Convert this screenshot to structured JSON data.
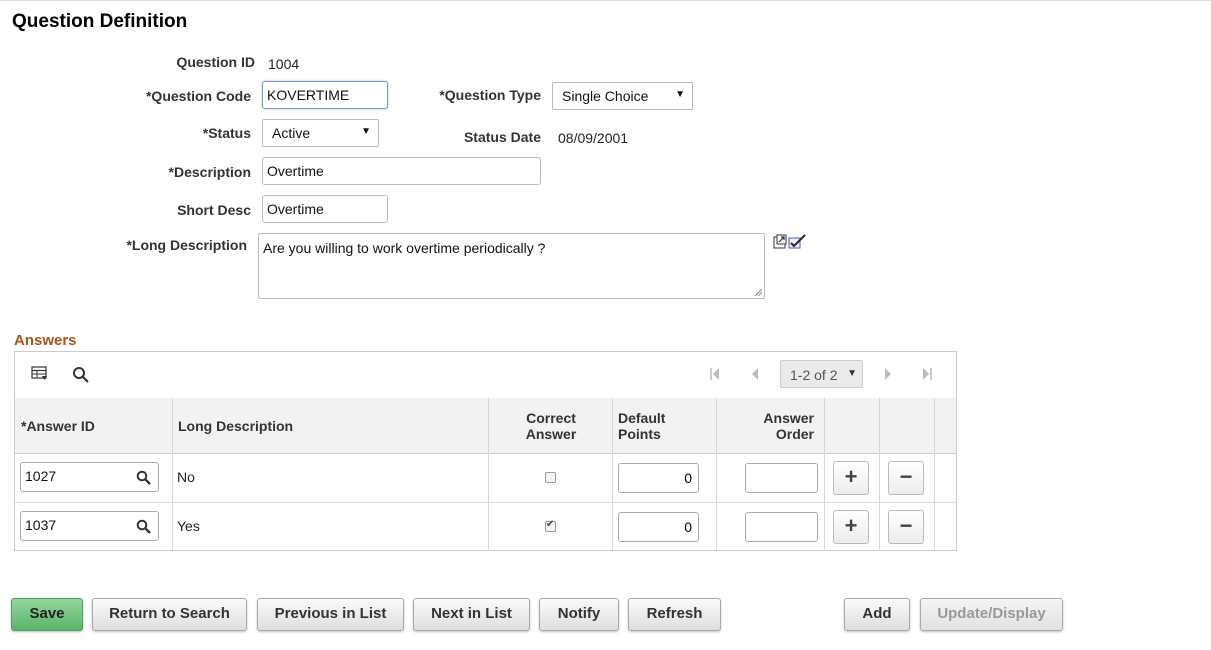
{
  "page": {
    "title": "Question Definition"
  },
  "form": {
    "question_id_label": "Question ID",
    "question_id": "1004",
    "question_code_label": "*Question Code",
    "question_code": "KOVERTIME",
    "question_type_label": "*Question Type",
    "question_type": "Single Choice",
    "status_label": "*Status",
    "status": "Active",
    "status_date_label": "Status Date",
    "status_date": "08/09/2001",
    "description_label": "*Description",
    "description": "Overtime",
    "short_desc_label": "Short Desc",
    "short_desc": "Overtime",
    "long_description_label": "*Long Description",
    "long_description": "Are you willing to work overtime periodically ?"
  },
  "answers": {
    "title": "Answers",
    "pagination": "1-2 of 2",
    "columns": {
      "answer_id": "*Answer ID",
      "long_description": "Long Description",
      "correct_answer_l1": "Correct",
      "correct_answer_l2": "Answer",
      "default_points_l1": "Default",
      "default_points_l2": "Points",
      "answer_order_l1": "Answer",
      "answer_order_l2": "Order"
    },
    "rows": [
      {
        "answer_id": "1027",
        "long_description": "No",
        "correct": false,
        "default_points": "0",
        "answer_order": ""
      },
      {
        "answer_id": "1037",
        "long_description": "Yes",
        "correct": true,
        "default_points": "0",
        "answer_order": ""
      }
    ]
  },
  "buttons": {
    "save": "Save",
    "return_to_search": "Return to Search",
    "previous_in_list": "Previous in List",
    "next_in_list": "Next in List",
    "notify": "Notify",
    "refresh": "Refresh",
    "add": "Add",
    "update_display": "Update/Display"
  },
  "colors": {
    "section_title": "#a5561b",
    "save_button": "#5ab46a"
  }
}
